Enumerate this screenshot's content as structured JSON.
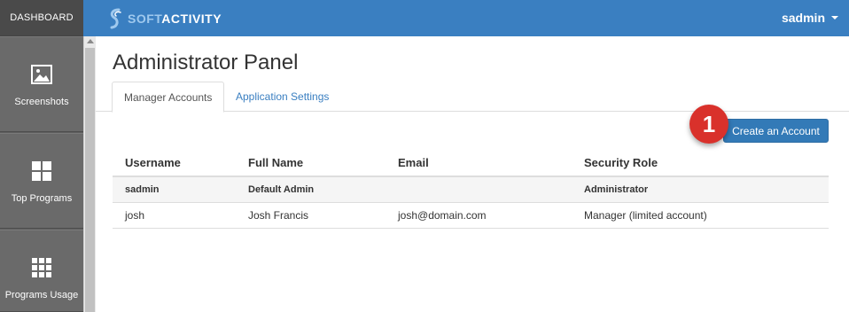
{
  "sidebar": {
    "header": "DASHBOARD",
    "items": [
      {
        "label": "Screenshots",
        "icon": "image-icon"
      },
      {
        "label": "Top Programs",
        "icon": "grid-four-icon"
      },
      {
        "label": "Programs Usage",
        "icon": "grid-nine-icon"
      }
    ]
  },
  "topbar": {
    "brand_part1": "SOFT",
    "brand_part2": "ACTIVITY",
    "user": "sadmin"
  },
  "main": {
    "title": "Administrator Panel",
    "tabs": [
      {
        "label": "Manager Accounts",
        "active": true
      },
      {
        "label": "Application Settings",
        "active": false
      }
    ],
    "create_button": "Create an Account",
    "step_badge": "1",
    "table": {
      "columns": [
        "Username",
        "Full Name",
        "Email",
        "Security Role"
      ],
      "rows": [
        {
          "username": "sadmin",
          "full_name": "Default Admin",
          "email": "",
          "role": "Administrator"
        },
        {
          "username": "josh",
          "full_name": "Josh Francis",
          "email": "josh@domain.com",
          "role": "Manager (limited account)"
        }
      ]
    }
  },
  "colors": {
    "topbar": "#3a7fc1",
    "sidebar": "#5e5e5e",
    "primary_button": "#337ab7",
    "badge": "#d9312b"
  }
}
